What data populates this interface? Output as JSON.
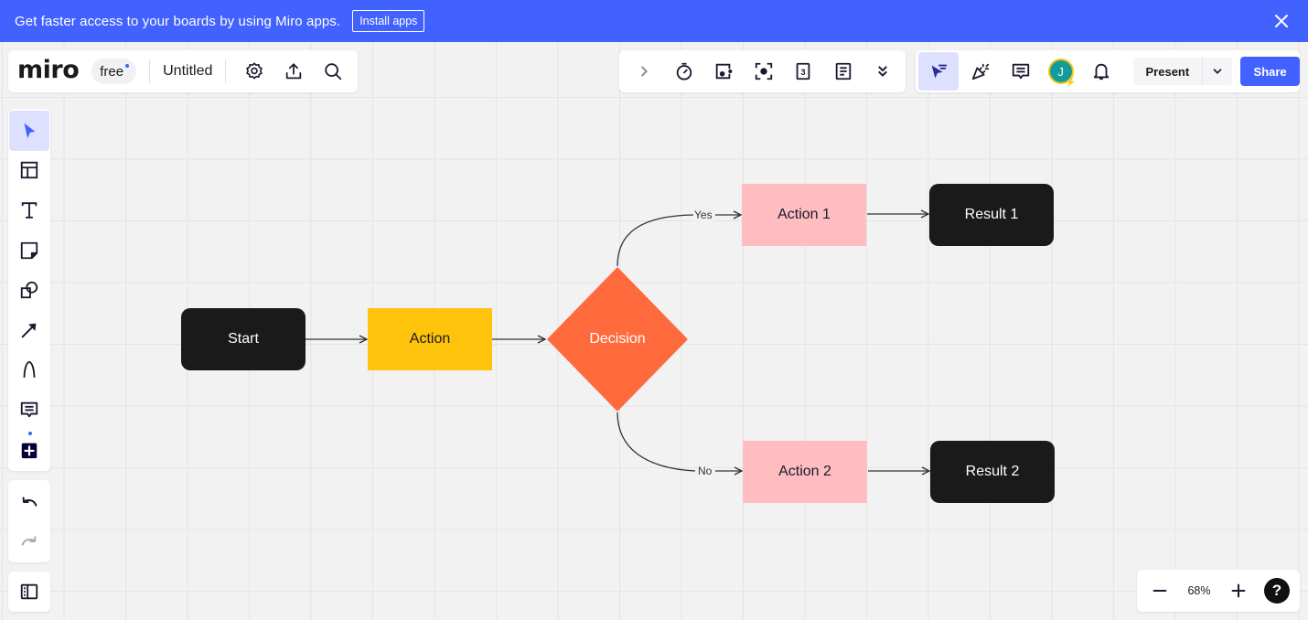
{
  "banner": {
    "text": "Get faster access to your boards by using Miro apps.",
    "install_label": "Install apps",
    "close_icon": "close-icon"
  },
  "header": {
    "logo": "miro",
    "plan": "free",
    "board_title": "Untitled",
    "icons": [
      "settings-icon",
      "upload-icon",
      "search-icon"
    ]
  },
  "collab_toolbar": {
    "icons": [
      "chevron-right-icon",
      "timer-icon",
      "voting-icon",
      "focus-icon",
      "card-icon",
      "notes-icon",
      "more-icon"
    ]
  },
  "right_toolbar": {
    "icons": [
      "cursor-filter-icon",
      "reactions-icon",
      "comments-icon",
      "avatar",
      "bell-icon"
    ],
    "avatar_initial": "J",
    "present_label": "Present",
    "share_label": "Share",
    "accent_color": "#4262ff"
  },
  "left_toolbar": {
    "tools": [
      "select",
      "templates",
      "text",
      "sticky-note",
      "shapes",
      "connector",
      "pen",
      "comment",
      "more-apps"
    ],
    "active_tool": "select",
    "history": [
      "undo",
      "redo"
    ]
  },
  "zoom": {
    "value": "68%",
    "minus_label": "−",
    "plus_label": "+",
    "help_label": "?"
  },
  "diagram": {
    "nodes": {
      "start": {
        "label": "Start",
        "color": "#1a1a1a"
      },
      "action": {
        "label": "Action",
        "color": "#fec30a"
      },
      "decision": {
        "label": "Decision",
        "color": "#ff6a3d"
      },
      "action1": {
        "label": "Action 1",
        "color": "#ffbdbf"
      },
      "action2": {
        "label": "Action 2",
        "color": "#ffbdbf"
      },
      "result1": {
        "label": "Result 1",
        "color": "#1a1a1a"
      },
      "result2": {
        "label": "Result 2",
        "color": "#1a1a1a"
      }
    },
    "edges": [
      {
        "from": "start",
        "to": "action",
        "label": ""
      },
      {
        "from": "action",
        "to": "decision",
        "label": ""
      },
      {
        "from": "decision",
        "to": "action1",
        "label": "Yes"
      },
      {
        "from": "decision",
        "to": "action2",
        "label": "No"
      },
      {
        "from": "action1",
        "to": "result1",
        "label": ""
      },
      {
        "from": "action2",
        "to": "result2",
        "label": ""
      }
    ],
    "edge_labels": {
      "yes": "Yes",
      "no": "No"
    }
  }
}
